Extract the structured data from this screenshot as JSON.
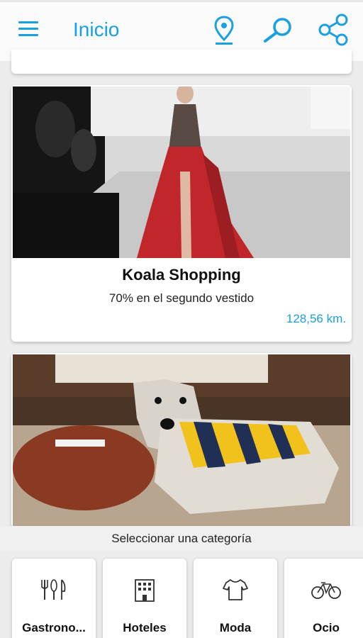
{
  "appbar": {
    "title": "Inicio",
    "icons": [
      "menu-icon",
      "location-pin-icon",
      "search-icon",
      "share-icon"
    ]
  },
  "cards": [
    {
      "title": "Koala Shopping",
      "subtitle": "70% en el segundo vestido",
      "distance": "128,56  km."
    }
  ],
  "category_bar": {
    "label": "Seleccionar una categoría"
  },
  "categories": [
    {
      "label": "Gastrono...",
      "icon": "cutlery-icon"
    },
    {
      "label": "Hoteles",
      "icon": "hotel-building-icon"
    },
    {
      "label": "Moda",
      "icon": "tshirt-icon"
    },
    {
      "label": "Ocio",
      "icon": "bicycle-icon"
    }
  ],
  "colors": {
    "accent": "#1aa0e0",
    "background": "#ececec"
  }
}
